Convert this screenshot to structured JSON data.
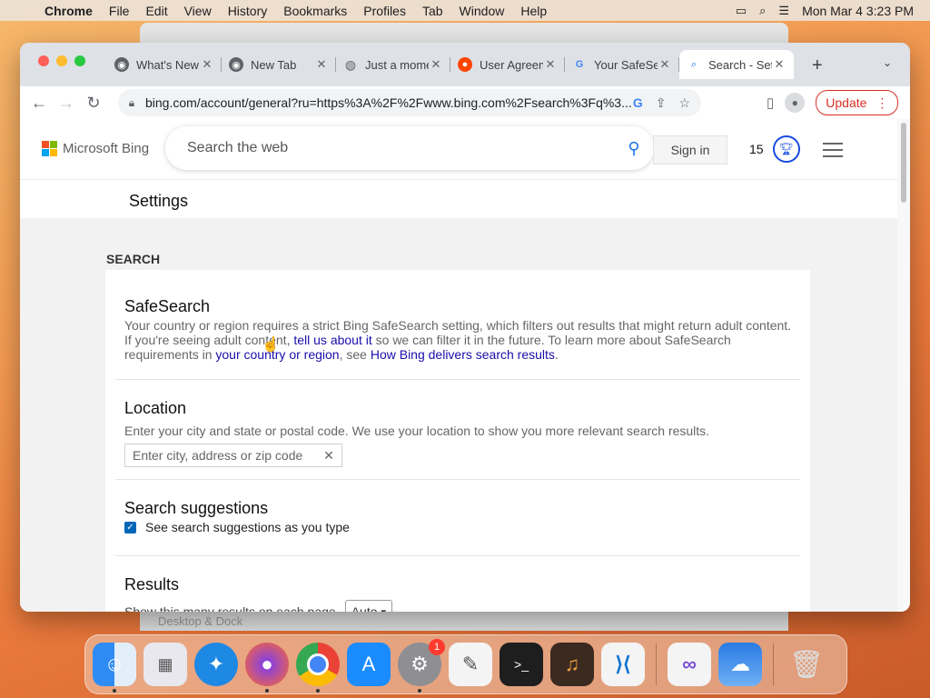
{
  "menubar": {
    "app_name": "Chrome",
    "items": [
      "File",
      "Edit",
      "View",
      "History",
      "Bookmarks",
      "Profiles",
      "Tab",
      "Window",
      "Help"
    ],
    "datetime": "Mon Mar 4  3:23 PM"
  },
  "background_window": {
    "label": "Desktop & Dock"
  },
  "browser": {
    "tabs": [
      {
        "title": "What's New",
        "icon": "chrome-icon"
      },
      {
        "title": "New Tab",
        "icon": "chrome-icon"
      },
      {
        "title": "Just a moment",
        "icon": "globe-icon"
      },
      {
        "title": "User Agreement",
        "icon": "reddit-icon"
      },
      {
        "title": "Your SafeSearch",
        "icon": "google-icon"
      },
      {
        "title": "Search - Settings",
        "icon": "bing-search-icon",
        "active": true
      }
    ],
    "url": "bing.com/account/general?ru=https%3A%2F%2Fwww.bing.com%2Fsearch%3Fq%3...",
    "update_label": "Update"
  },
  "bing": {
    "brand": "Microsoft Bing",
    "search_placeholder": "Search the web",
    "signin_label": "Sign in",
    "rewards_count": "15"
  },
  "settings": {
    "title": "Settings",
    "section": "SEARCH",
    "safesearch": {
      "title": "SafeSearch",
      "text_1": "Your country or region requires a strict Bing SafeSearch setting, which filters out results that might return adult content. If you're seeing adult content, ",
      "link_1": "tell us about it",
      "text_2": " so we can filter it in the future. To learn more about SafeSearch requirements in ",
      "link_2": "your country or region",
      "text_3": ", see ",
      "link_3": "How Bing delivers search results",
      "text_4": "."
    },
    "location": {
      "title": "Location",
      "description": "Enter your city and state or postal code. We use your location to show you more relevant search results.",
      "placeholder": "Enter city, address or zip code"
    },
    "suggestions": {
      "title": "Search suggestions",
      "checkbox_label": "See search suggestions as you type",
      "checked": true
    },
    "results": {
      "title": "Results",
      "label": "Show this many results on each page",
      "selected": "Auto"
    }
  },
  "dock": {
    "apps": [
      "Finder",
      "Launchpad",
      "Safari",
      "Firefox",
      "Chrome",
      "App Store",
      "System Preferences",
      "TextEdit",
      "Terminal",
      "GarageBand",
      "VS Code",
      "Visual Studio",
      "Weather",
      "Trash"
    ],
    "system_prefs_badge": "1"
  }
}
